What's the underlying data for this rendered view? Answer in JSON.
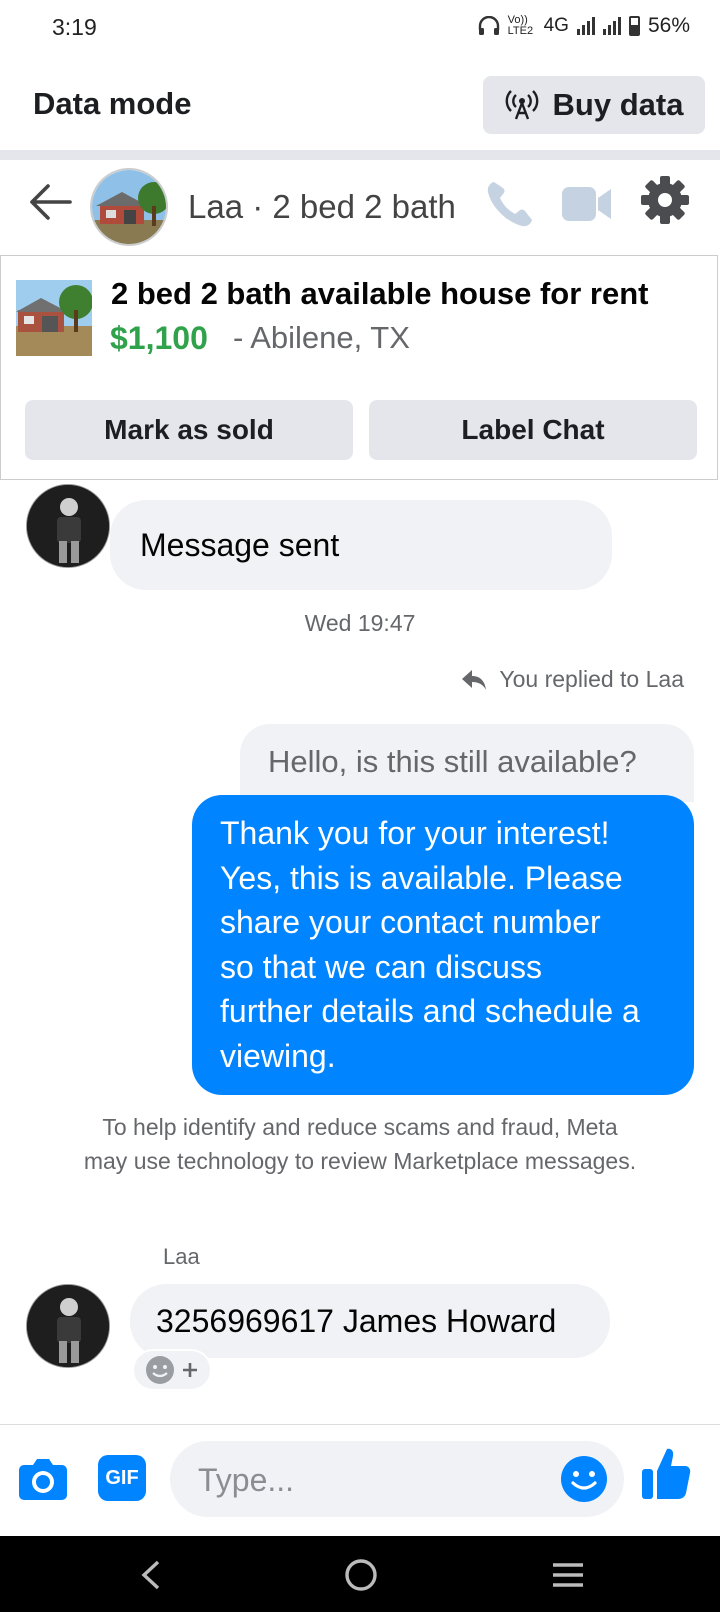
{
  "status_bar": {
    "time": "3:19",
    "network": "4G",
    "volte": "Vo)) LTE2",
    "battery": "56%"
  },
  "data_mode": {
    "title": "Data mode",
    "buy_label": "Buy data"
  },
  "chat_header": {
    "name": "Laa · 2 bed 2 bath"
  },
  "listing": {
    "title": "2 bed 2 bath available house for rent",
    "price": "$1,100",
    "location": "- Abilene, TX",
    "mark_sold_label": "Mark as sold",
    "label_chat_label": "Label Chat"
  },
  "messages": {
    "first_incoming": "Message sent",
    "timestamp": "Wed 19:47",
    "replied_notice": "You replied to Laa",
    "quoted_text": "Hello, is this still available?",
    "outgoing_lines": [
      "Thank you for your interest!",
      "Yes, this is available. Please",
      "share your contact number",
      "so that we can discuss",
      "further details and schedule a",
      "viewing."
    ],
    "safety_notice": "To help identify and reduce scams and fraud, Meta may use technology to review Marketplace messages.",
    "sender_name": "Laa",
    "last_incoming": "3256969617 James Howard"
  },
  "composer": {
    "placeholder": "Type...",
    "gif_label": "GIF"
  },
  "colors": {
    "messenger_blue": "#0084ff",
    "price_green": "#31a24c",
    "bubble_gray": "#f0f2f5",
    "button_gray": "#e4e6eb"
  },
  "icons": [
    "back-arrow-icon",
    "phone-icon",
    "video-camera-icon",
    "gear-icon",
    "broadcast-icon",
    "reply-arrow-icon",
    "camera-icon",
    "gif-icon",
    "emoji-icon",
    "thumbs-up-icon",
    "add-reaction-icon",
    "nav-back-icon",
    "nav-home-icon",
    "nav-recents-icon"
  ]
}
